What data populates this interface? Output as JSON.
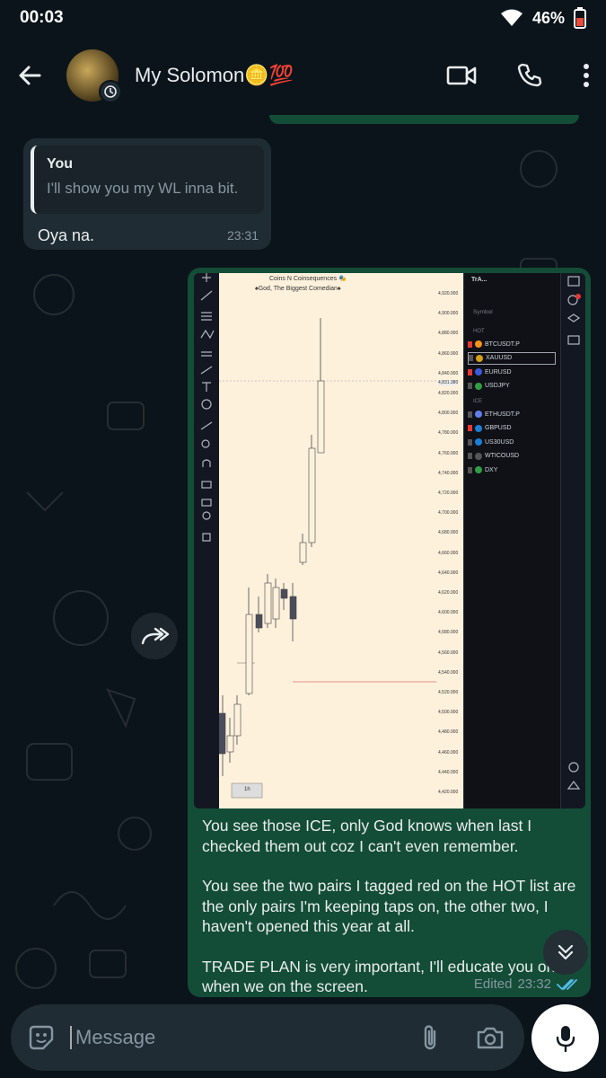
{
  "status": {
    "time": "00:03",
    "battery": "46%"
  },
  "header": {
    "contact_name": "My Solomon🪙💯"
  },
  "reply_message": {
    "quote_author": "You",
    "quote_text": "I'll show you my WL inna bit.",
    "text": "Oya na.",
    "time": "23:31"
  },
  "screenshot": {
    "chart_title": "Coins N Coinsequences 🎭",
    "chart_subtitle": "♠God, The Biggest Comedian♠",
    "price_labels": [
      "4,920.000",
      "4,900.000",
      "4,880.000",
      "4,860.000",
      "4,840.000",
      "4,831.380",
      "4,820.000",
      "4,800.000",
      "4,780.000",
      "4,760.000",
      "4,740.000",
      "4,720.000",
      "4,700.000",
      "4,680.000",
      "4,660.000",
      "4,640.000",
      "4,620.000",
      "4,600.000",
      "4,580.000",
      "4,560.000",
      "4,540.000",
      "4,520.000",
      "4,500.000",
      "4,480.000",
      "4,460.000",
      "4,440.000",
      "4,420.000"
    ],
    "timeframe": "1h",
    "watchlist_header": "TrA...",
    "symbol_label": "Symbol",
    "hot_label": "HOT",
    "hot": [
      "BTCUSDT.P",
      "XAUUSD",
      "EURUSD",
      "USDJPY"
    ],
    "ice_label": "ICE",
    "ice": [
      "ETHUSDT.P",
      "GBPUSD",
      "US30USD",
      "WTICOUSD",
      "DXY"
    ]
  },
  "caption": [
    "You see those ICE, only God knows when last I checked them out coz I can't even remember.",
    "You see the two pairs I tagged red on the HOT list are the only pairs I'm keeping taps on, the other two, I haven't opened this year at all.",
    "TRADE PLAN is very important, I'll educate you on it when we on the screen."
  ],
  "message_meta": {
    "edited": "Edited",
    "time": "23:32",
    "read_color": "#53bdeb"
  },
  "composer": {
    "placeholder": "Message"
  },
  "colors": {
    "bubble_out": "#144d37",
    "bubble_in": "#202c33",
    "background": "#0b141a"
  }
}
